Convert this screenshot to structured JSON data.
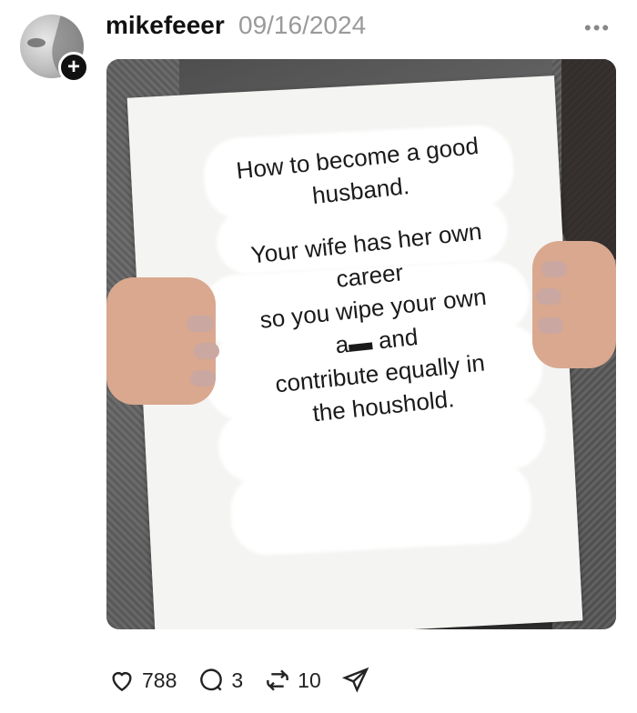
{
  "post": {
    "username": "mikefeeer",
    "date": "09/16/2024",
    "more_label": "•••",
    "follow_label": "+"
  },
  "image": {
    "sign_lines": [
      "How to become a good",
      "husband.",
      "",
      "Your wife has her own",
      "career",
      "so you wipe your own",
      "a▬ and",
      "contribute equally in",
      "the houshold."
    ]
  },
  "actions": {
    "likes": "788",
    "comments": "3",
    "reposts": "10"
  },
  "icons": [
    "heart-icon",
    "comment-icon",
    "repost-icon",
    "share-icon",
    "more-icon",
    "plus-icon"
  ]
}
